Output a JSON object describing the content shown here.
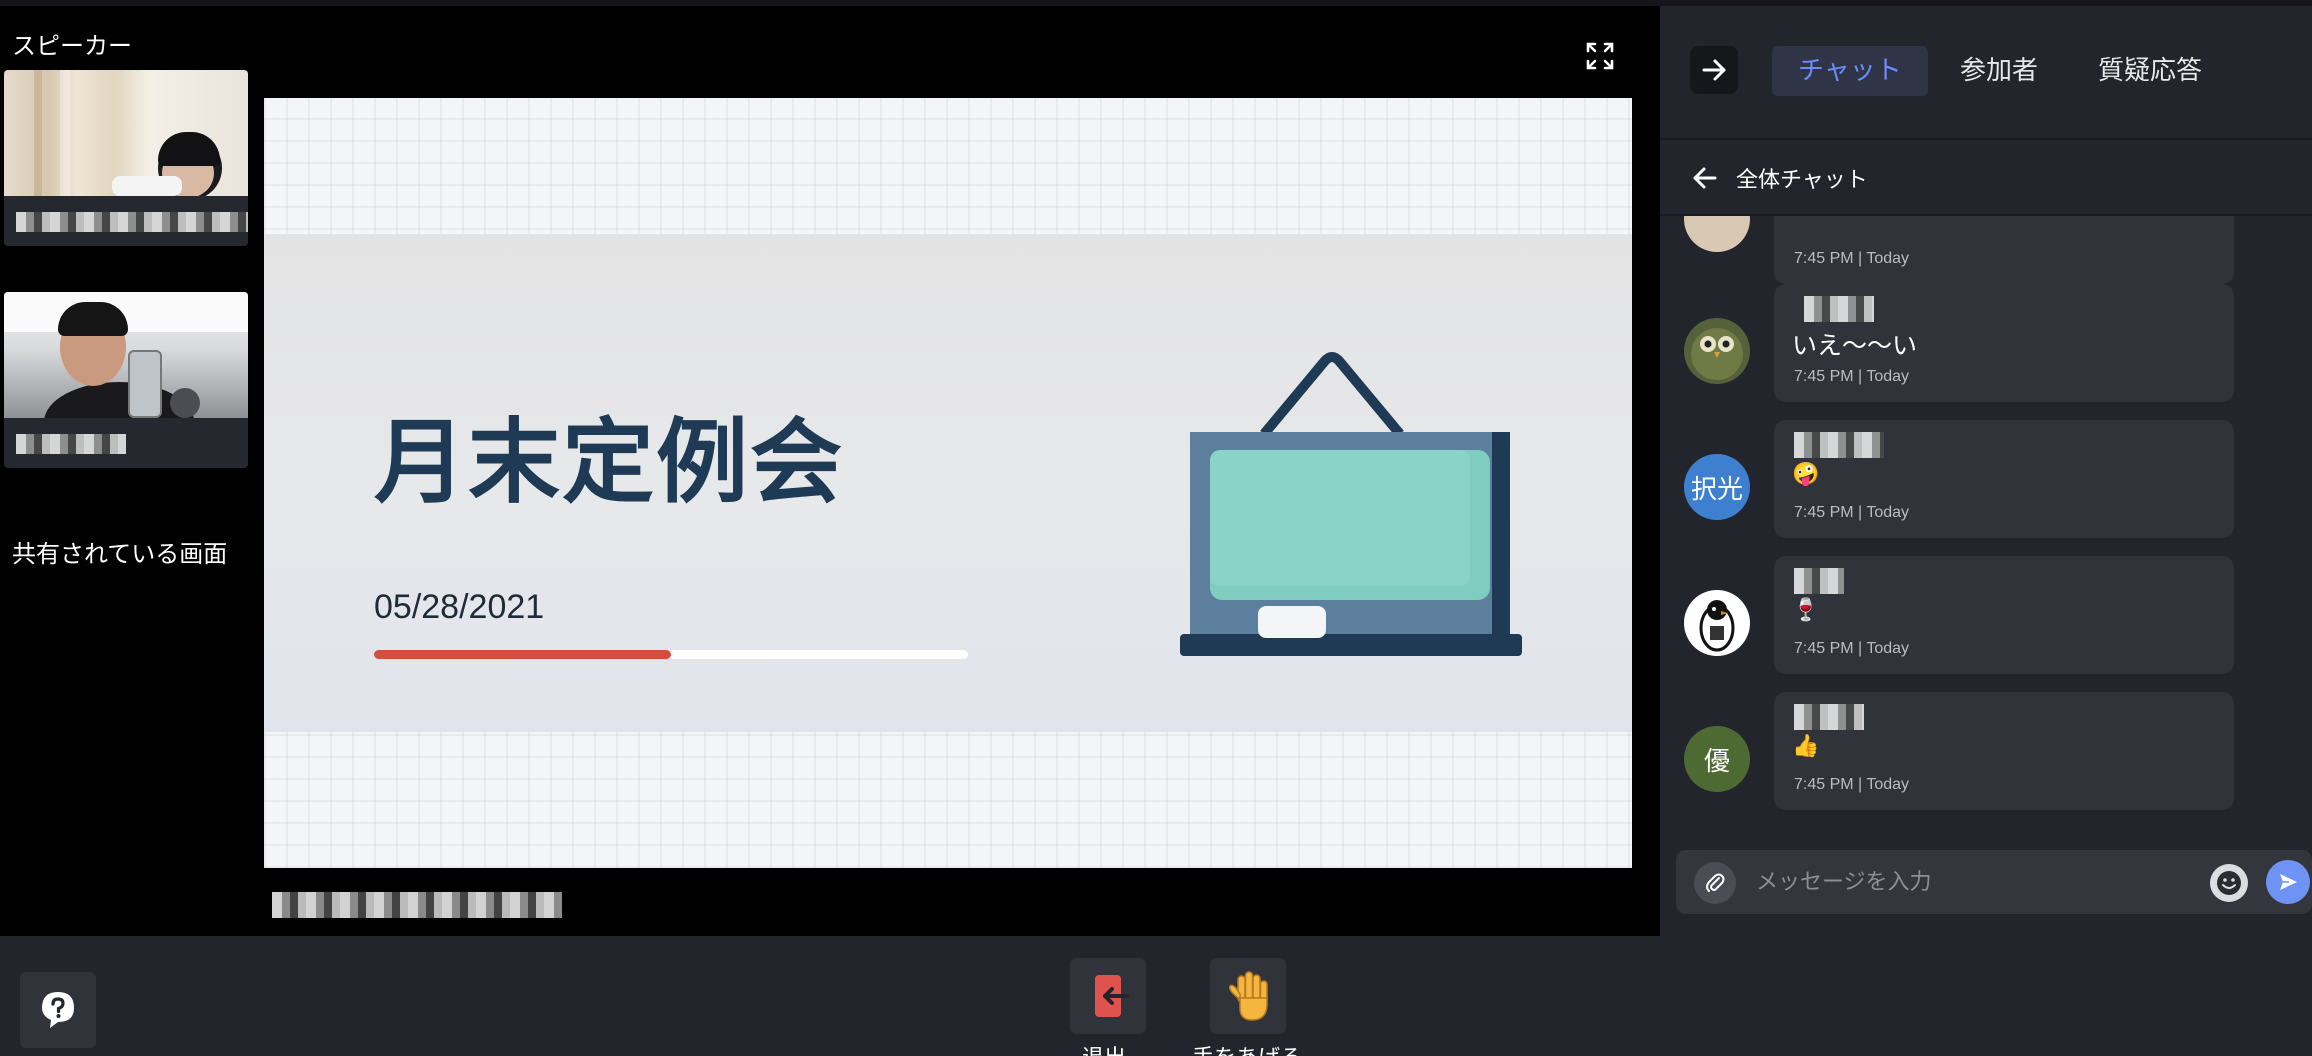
{
  "stage": {
    "speakers_label": "スピーカー",
    "shared_screen_label": "共有されている画面",
    "slide": {
      "title": "月末定例会",
      "date": "05/28/2021",
      "progress_fraction": 0.5
    }
  },
  "panel": {
    "tabs": [
      {
        "label": "チャット",
        "active": true
      },
      {
        "label": "参加者",
        "active": false
      },
      {
        "label": "質疑応答",
        "active": false
      }
    ],
    "chat_title": "全体チャット",
    "messages": [
      {
        "avatar_text": "",
        "text": "",
        "time": "7:45 PM | Today"
      },
      {
        "avatar_text": "",
        "text": "いえ〜〜い",
        "time": "7:45 PM | Today"
      },
      {
        "avatar_text": "択光",
        "text": "🤪",
        "time": "7:45 PM | Today"
      },
      {
        "avatar_text": "",
        "text": "🍷",
        "time": "7:45 PM | Today"
      },
      {
        "avatar_text": "優",
        "text": "👍",
        "time": "7:45 PM | Today"
      }
    ],
    "composer_placeholder": "メッセージを入力"
  },
  "bottombar": {
    "leave_label": "退出",
    "raise_hand_label": "手をあげる"
  },
  "colors": {
    "accent": "#6e8cff",
    "leave_red": "#e0524d",
    "avatar_blue": "#3f7fd0",
    "avatar_green": "#4e6a33"
  }
}
